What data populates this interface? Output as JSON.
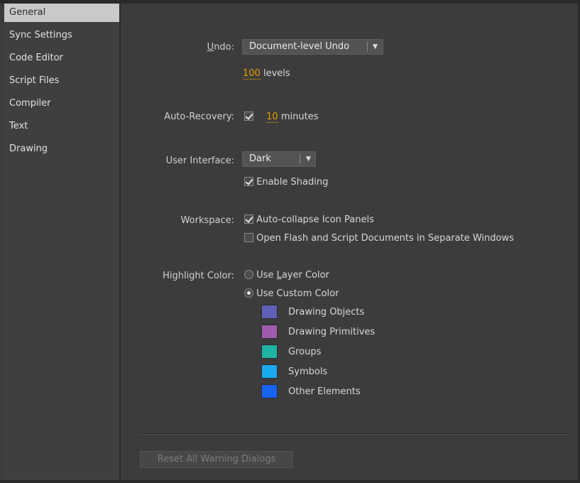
{
  "sidebar": {
    "items": [
      {
        "label": "General",
        "selected": true
      },
      {
        "label": "Sync Settings"
      },
      {
        "label": "Code Editor"
      },
      {
        "label": "Script Files"
      },
      {
        "label": "Compiler"
      },
      {
        "label": "Text"
      },
      {
        "label": "Drawing"
      }
    ]
  },
  "general": {
    "undo": {
      "label_accel": "U",
      "label_rest": "ndo:",
      "value": "Document-level Undo",
      "levels_value": "100",
      "levels_suffix": " levels"
    },
    "auto_recovery": {
      "label": "Auto-Recovery:",
      "checked": true,
      "minutes_value": "10",
      "minutes_suffix": " minutes"
    },
    "user_interface": {
      "label": "User Interface:",
      "value": "Dark",
      "enable_shading": "Enable Shading",
      "enable_shading_checked": true
    },
    "workspace": {
      "label": "Workspace:",
      "auto_collapse": "Auto-collapse Icon Panels",
      "auto_collapse_checked": true,
      "separate_windows": "Open Flash and Script Documents in Separate Windows",
      "separate_windows_checked": false
    },
    "highlight_color": {
      "label": "Highlight Color:",
      "use_layer_color_pre": "Use ",
      "use_layer_color_accel": "L",
      "use_layer_color_post": "ayer Color",
      "use_custom_color": "Use Custom Color",
      "selected": "custom",
      "swatches": [
        {
          "label": "Drawing Objects",
          "color": "#6060b8"
        },
        {
          "label": "Drawing Primitives",
          "color": "#a05aae"
        },
        {
          "label": "Groups",
          "color": "#1fb3a3"
        },
        {
          "label": "Symbols",
          "color": "#19a9f0"
        },
        {
          "label": "Other Elements",
          "color": "#1762f7"
        }
      ]
    },
    "reset_button": "Reset All Warning Dialogs"
  }
}
